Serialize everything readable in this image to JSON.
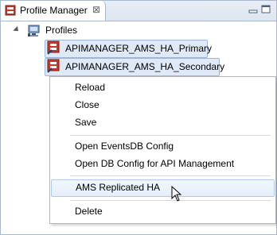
{
  "view": {
    "title": "Profile Manager",
    "close_glyph": "⊠"
  },
  "tree": {
    "root_label": "Profiles",
    "children": [
      {
        "label": "APIMANAGER_AMS_HA_Primary"
      },
      {
        "label": "APIMANAGER_AMS_HA_Secondary"
      }
    ]
  },
  "context_menu": {
    "groups": [
      [
        "Reload",
        "Close",
        "Save"
      ],
      [
        "Open EventsDB Config",
        "Open DB Config for API Management"
      ],
      [
        "AMS Replicated HA"
      ],
      [
        "Delete"
      ]
    ],
    "hovered_item": "AMS Replicated HA"
  },
  "icons": {
    "tab": "profile-manager-icon",
    "root": "computer-icon",
    "child": "server-profile-icon",
    "minimize": "minimize-icon",
    "maximize": "maximize-icon"
  },
  "colors": {
    "selection_fill": "#dfe9f7",
    "selection_border": "#9db7dc",
    "menu_hover": "#e4eefb",
    "frame_border": "#a9b8cc"
  }
}
